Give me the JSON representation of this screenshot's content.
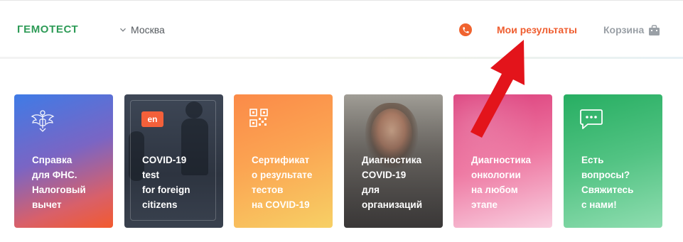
{
  "header": {
    "logo": "ГЕМОТЕСТ",
    "city": "Москва",
    "results_link": "Мои результаты",
    "cart_link": "Корзина",
    "accent_color": "#ef5d2f",
    "brand_color": "#2e9b57"
  },
  "cards": [
    {
      "title": "Справка\nдля ФНС.\nНалоговый\nвычет",
      "icon": "emblem-icon"
    },
    {
      "title": "COVID-19\ntest\nfor foreign\ncitizens",
      "badge": "en"
    },
    {
      "title": "Сертификат\nо результате\nтестов\nна COVID-19",
      "icon": "qr-code-icon"
    },
    {
      "title": "Диагностика\nCOVID-19\nдля\nорганизаций"
    },
    {
      "title": "Диагностика\nонкологии\nна любом\nэтапе"
    },
    {
      "title": "Есть\nвопросы?\nСвяжитесь\nс нами!",
      "icon": "chat-icon"
    }
  ]
}
